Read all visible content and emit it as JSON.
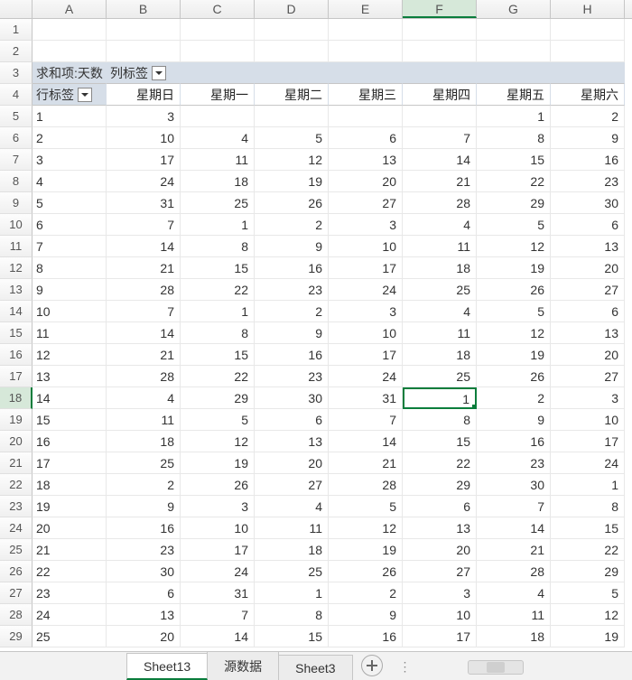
{
  "col_letters": [
    "A",
    "B",
    "C",
    "D",
    "E",
    "F",
    "G",
    "H"
  ],
  "selected_col_idx": 5,
  "selected_row_idx": 18,
  "pivot": {
    "data_field": "求和项:天数",
    "col_label": "列标签",
    "row_label": "行标签",
    "columns": [
      "星期日",
      "星期一",
      "星期二",
      "星期三",
      "星期四",
      "星期五",
      "星期六"
    ]
  },
  "rows": [
    {
      "label": "1",
      "vals": [
        3,
        null,
        null,
        null,
        null,
        1,
        2
      ]
    },
    {
      "label": "2",
      "vals": [
        10,
        4,
        5,
        6,
        7,
        8,
        9
      ]
    },
    {
      "label": "3",
      "vals": [
        17,
        11,
        12,
        13,
        14,
        15,
        16
      ]
    },
    {
      "label": "4",
      "vals": [
        24,
        18,
        19,
        20,
        21,
        22,
        23
      ]
    },
    {
      "label": "5",
      "vals": [
        31,
        25,
        26,
        27,
        28,
        29,
        30
      ]
    },
    {
      "label": "6",
      "vals": [
        7,
        1,
        2,
        3,
        4,
        5,
        6
      ]
    },
    {
      "label": "7",
      "vals": [
        14,
        8,
        9,
        10,
        11,
        12,
        13
      ]
    },
    {
      "label": "8",
      "vals": [
        21,
        15,
        16,
        17,
        18,
        19,
        20
      ]
    },
    {
      "label": "9",
      "vals": [
        28,
        22,
        23,
        24,
        25,
        26,
        27
      ]
    },
    {
      "label": "10",
      "vals": [
        7,
        1,
        2,
        3,
        4,
        5,
        6
      ]
    },
    {
      "label": "11",
      "vals": [
        14,
        8,
        9,
        10,
        11,
        12,
        13
      ]
    },
    {
      "label": "12",
      "vals": [
        21,
        15,
        16,
        17,
        18,
        19,
        20
      ]
    },
    {
      "label": "13",
      "vals": [
        28,
        22,
        23,
        24,
        25,
        26,
        27
      ]
    },
    {
      "label": "14",
      "vals": [
        4,
        29,
        30,
        31,
        1,
        2,
        3
      ]
    },
    {
      "label": "15",
      "vals": [
        11,
        5,
        6,
        7,
        8,
        9,
        10
      ]
    },
    {
      "label": "16",
      "vals": [
        18,
        12,
        13,
        14,
        15,
        16,
        17
      ]
    },
    {
      "label": "17",
      "vals": [
        25,
        19,
        20,
        21,
        22,
        23,
        24
      ]
    },
    {
      "label": "18",
      "vals": [
        2,
        26,
        27,
        28,
        29,
        30,
        1
      ]
    },
    {
      "label": "19",
      "vals": [
        9,
        3,
        4,
        5,
        6,
        7,
        8
      ]
    },
    {
      "label": "20",
      "vals": [
        16,
        10,
        11,
        12,
        13,
        14,
        15
      ]
    },
    {
      "label": "21",
      "vals": [
        23,
        17,
        18,
        19,
        20,
        21,
        22
      ]
    },
    {
      "label": "22",
      "vals": [
        30,
        24,
        25,
        26,
        27,
        28,
        29
      ]
    },
    {
      "label": "23",
      "vals": [
        6,
        31,
        1,
        2,
        3,
        4,
        5
      ]
    },
    {
      "label": "24",
      "vals": [
        13,
        7,
        8,
        9,
        10,
        11,
        12
      ]
    },
    {
      "label": "25",
      "vals": [
        20,
        14,
        15,
        16,
        17,
        18,
        19
      ]
    }
  ],
  "tabs": {
    "items": [
      {
        "name": "Sheet13",
        "active": true
      },
      {
        "name": "源数据",
        "active": false
      },
      {
        "name": "Sheet3",
        "active": false
      }
    ]
  },
  "chart_data": {
    "type": "table",
    "title": "求和项:天数",
    "row_field": "行标签",
    "col_field": "列标签",
    "columns": [
      "星期日",
      "星期一",
      "星期二",
      "星期三",
      "星期四",
      "星期五",
      "星期六"
    ],
    "row_labels": [
      "1",
      "2",
      "3",
      "4",
      "5",
      "6",
      "7",
      "8",
      "9",
      "10",
      "11",
      "12",
      "13",
      "14",
      "15",
      "16",
      "17",
      "18",
      "19",
      "20",
      "21",
      "22",
      "23",
      "24",
      "25"
    ],
    "values": [
      [
        3,
        null,
        null,
        null,
        null,
        1,
        2
      ],
      [
        10,
        4,
        5,
        6,
        7,
        8,
        9
      ],
      [
        17,
        11,
        12,
        13,
        14,
        15,
        16
      ],
      [
        24,
        18,
        19,
        20,
        21,
        22,
        23
      ],
      [
        31,
        25,
        26,
        27,
        28,
        29,
        30
      ],
      [
        7,
        1,
        2,
        3,
        4,
        5,
        6
      ],
      [
        14,
        8,
        9,
        10,
        11,
        12,
        13
      ],
      [
        21,
        15,
        16,
        17,
        18,
        19,
        20
      ],
      [
        28,
        22,
        23,
        24,
        25,
        26,
        27
      ],
      [
        7,
        1,
        2,
        3,
        4,
        5,
        6
      ],
      [
        14,
        8,
        9,
        10,
        11,
        12,
        13
      ],
      [
        21,
        15,
        16,
        17,
        18,
        19,
        20
      ],
      [
        28,
        22,
        23,
        24,
        25,
        26,
        27
      ],
      [
        4,
        29,
        30,
        31,
        1,
        2,
        3
      ],
      [
        11,
        5,
        6,
        7,
        8,
        9,
        10
      ],
      [
        18,
        12,
        13,
        14,
        15,
        16,
        17
      ],
      [
        25,
        19,
        20,
        21,
        22,
        23,
        24
      ],
      [
        2,
        26,
        27,
        28,
        29,
        30,
        1
      ],
      [
        9,
        3,
        4,
        5,
        6,
        7,
        8
      ],
      [
        16,
        10,
        11,
        12,
        13,
        14,
        15
      ],
      [
        23,
        17,
        18,
        19,
        20,
        21,
        22
      ],
      [
        30,
        24,
        25,
        26,
        27,
        28,
        29
      ],
      [
        6,
        31,
        1,
        2,
        3,
        4,
        5
      ],
      [
        13,
        7,
        8,
        9,
        10,
        11,
        12
      ],
      [
        20,
        14,
        15,
        16,
        17,
        18,
        19
      ]
    ]
  }
}
